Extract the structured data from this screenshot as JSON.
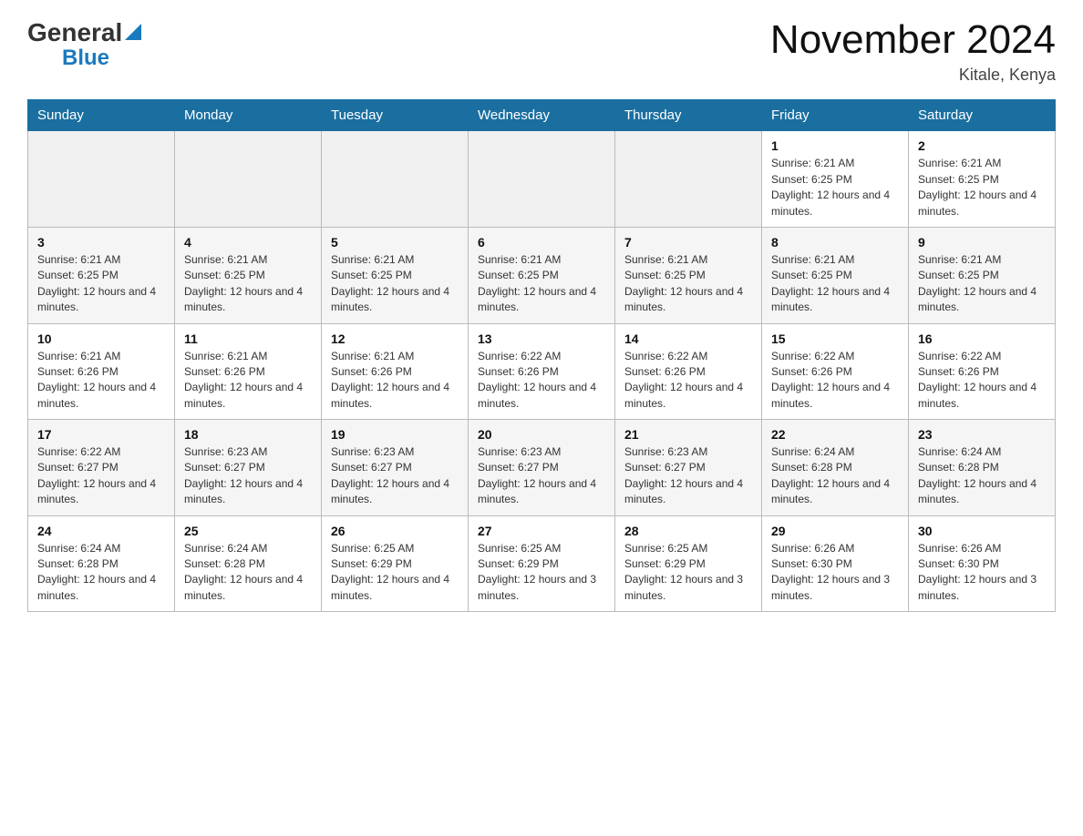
{
  "logo": {
    "general": "General",
    "blue": "Blue"
  },
  "title": {
    "month": "November 2024",
    "location": "Kitale, Kenya"
  },
  "weekdays": [
    "Sunday",
    "Monday",
    "Tuesday",
    "Wednesday",
    "Thursday",
    "Friday",
    "Saturday"
  ],
  "weeks": [
    [
      {
        "day": "",
        "info": ""
      },
      {
        "day": "",
        "info": ""
      },
      {
        "day": "",
        "info": ""
      },
      {
        "day": "",
        "info": ""
      },
      {
        "day": "",
        "info": ""
      },
      {
        "day": "1",
        "info": "Sunrise: 6:21 AM\nSunset: 6:25 PM\nDaylight: 12 hours and 4 minutes."
      },
      {
        "day": "2",
        "info": "Sunrise: 6:21 AM\nSunset: 6:25 PM\nDaylight: 12 hours and 4 minutes."
      }
    ],
    [
      {
        "day": "3",
        "info": "Sunrise: 6:21 AM\nSunset: 6:25 PM\nDaylight: 12 hours and 4 minutes."
      },
      {
        "day": "4",
        "info": "Sunrise: 6:21 AM\nSunset: 6:25 PM\nDaylight: 12 hours and 4 minutes."
      },
      {
        "day": "5",
        "info": "Sunrise: 6:21 AM\nSunset: 6:25 PM\nDaylight: 12 hours and 4 minutes."
      },
      {
        "day": "6",
        "info": "Sunrise: 6:21 AM\nSunset: 6:25 PM\nDaylight: 12 hours and 4 minutes."
      },
      {
        "day": "7",
        "info": "Sunrise: 6:21 AM\nSunset: 6:25 PM\nDaylight: 12 hours and 4 minutes."
      },
      {
        "day": "8",
        "info": "Sunrise: 6:21 AM\nSunset: 6:25 PM\nDaylight: 12 hours and 4 minutes."
      },
      {
        "day": "9",
        "info": "Sunrise: 6:21 AM\nSunset: 6:25 PM\nDaylight: 12 hours and 4 minutes."
      }
    ],
    [
      {
        "day": "10",
        "info": "Sunrise: 6:21 AM\nSunset: 6:26 PM\nDaylight: 12 hours and 4 minutes."
      },
      {
        "day": "11",
        "info": "Sunrise: 6:21 AM\nSunset: 6:26 PM\nDaylight: 12 hours and 4 minutes."
      },
      {
        "day": "12",
        "info": "Sunrise: 6:21 AM\nSunset: 6:26 PM\nDaylight: 12 hours and 4 minutes."
      },
      {
        "day": "13",
        "info": "Sunrise: 6:22 AM\nSunset: 6:26 PM\nDaylight: 12 hours and 4 minutes."
      },
      {
        "day": "14",
        "info": "Sunrise: 6:22 AM\nSunset: 6:26 PM\nDaylight: 12 hours and 4 minutes."
      },
      {
        "day": "15",
        "info": "Sunrise: 6:22 AM\nSunset: 6:26 PM\nDaylight: 12 hours and 4 minutes."
      },
      {
        "day": "16",
        "info": "Sunrise: 6:22 AM\nSunset: 6:26 PM\nDaylight: 12 hours and 4 minutes."
      }
    ],
    [
      {
        "day": "17",
        "info": "Sunrise: 6:22 AM\nSunset: 6:27 PM\nDaylight: 12 hours and 4 minutes."
      },
      {
        "day": "18",
        "info": "Sunrise: 6:23 AM\nSunset: 6:27 PM\nDaylight: 12 hours and 4 minutes."
      },
      {
        "day": "19",
        "info": "Sunrise: 6:23 AM\nSunset: 6:27 PM\nDaylight: 12 hours and 4 minutes."
      },
      {
        "day": "20",
        "info": "Sunrise: 6:23 AM\nSunset: 6:27 PM\nDaylight: 12 hours and 4 minutes."
      },
      {
        "day": "21",
        "info": "Sunrise: 6:23 AM\nSunset: 6:27 PM\nDaylight: 12 hours and 4 minutes."
      },
      {
        "day": "22",
        "info": "Sunrise: 6:24 AM\nSunset: 6:28 PM\nDaylight: 12 hours and 4 minutes."
      },
      {
        "day": "23",
        "info": "Sunrise: 6:24 AM\nSunset: 6:28 PM\nDaylight: 12 hours and 4 minutes."
      }
    ],
    [
      {
        "day": "24",
        "info": "Sunrise: 6:24 AM\nSunset: 6:28 PM\nDaylight: 12 hours and 4 minutes."
      },
      {
        "day": "25",
        "info": "Sunrise: 6:24 AM\nSunset: 6:28 PM\nDaylight: 12 hours and 4 minutes."
      },
      {
        "day": "26",
        "info": "Sunrise: 6:25 AM\nSunset: 6:29 PM\nDaylight: 12 hours and 4 minutes."
      },
      {
        "day": "27",
        "info": "Sunrise: 6:25 AM\nSunset: 6:29 PM\nDaylight: 12 hours and 3 minutes."
      },
      {
        "day": "28",
        "info": "Sunrise: 6:25 AM\nSunset: 6:29 PM\nDaylight: 12 hours and 3 minutes."
      },
      {
        "day": "29",
        "info": "Sunrise: 6:26 AM\nSunset: 6:30 PM\nDaylight: 12 hours and 3 minutes."
      },
      {
        "day": "30",
        "info": "Sunrise: 6:26 AM\nSunset: 6:30 PM\nDaylight: 12 hours and 3 minutes."
      }
    ]
  ]
}
